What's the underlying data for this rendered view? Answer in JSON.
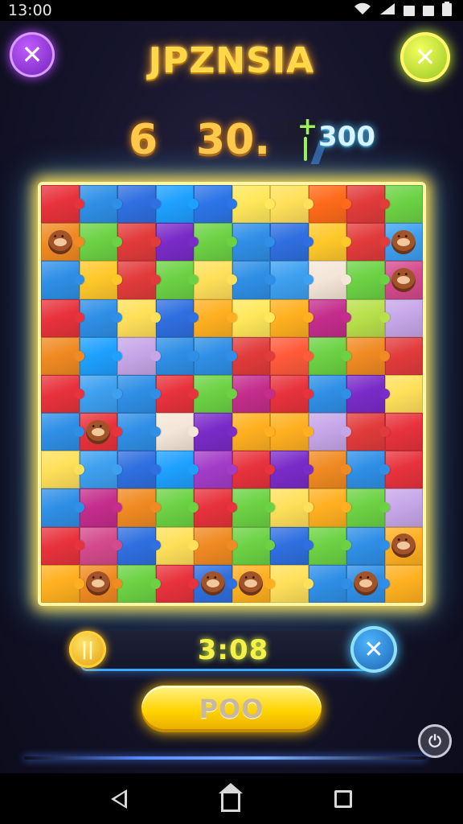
{
  "status_bar": {
    "time": "13:00",
    "icons": [
      "wifi-icon",
      "signal-icon",
      "notification-icon",
      "notification-icon",
      "battery-icon"
    ]
  },
  "header": {
    "title": "JPZNSIA",
    "left_button_icon": "close-icon",
    "right_button_icon": "close-icon"
  },
  "scores": {
    "left": "6",
    "middle": "30.",
    "plus_symbol": "+",
    "bonus": "300"
  },
  "board": {
    "columns": 10,
    "rows": 11,
    "tiles": [
      [
        "#e8323c",
        "#2f8fe6",
        "#2f6fe0",
        "#1ea0ff",
        "#2c75e8",
        "#ffe85a",
        "#ffe05a",
        "#ff6a1a",
        "#e23b3b",
        "#6cd244"
      ],
      [
        "#f08a22",
        "#6cd244",
        "#e23b3b",
        "#7a2bc8",
        "#6cd244",
        "#2f8fe6",
        "#2f6fe0",
        "#ffc82a",
        "#e23b3b",
        "#3da0f0"
      ],
      [
        "#2f8fe6",
        "#ffc82a",
        "#e23b3b",
        "#6cd244",
        "#ffe05a",
        "#2f8fe6",
        "#3da0f0",
        "#f4e6d8",
        "#6cd244",
        "#d44a8c"
      ],
      [
        "#e8323c",
        "#2f8fe6",
        "#ffe05a",
        "#2f6fe0",
        "#ffb020",
        "#ffe85a",
        "#ffb020",
        "#c42d8c",
        "#b8e04a",
        "#c6a6e8"
      ],
      [
        "#f08a22",
        "#1ea0ff",
        "#c6a6e8",
        "#2f8fe6",
        "#2f8fe6",
        "#e23b3b",
        "#ff5a3a",
        "#6cd244",
        "#f08a22",
        "#e23b3b"
      ],
      [
        "#e8323c",
        "#3da0f0",
        "#2f8fe6",
        "#e8323c",
        "#6cd244",
        "#c42d8c",
        "#e8323c",
        "#2f8fe6",
        "#7a2bc8",
        "#ffe05a"
      ],
      [
        "#2f8fe6",
        "#e8323c",
        "#2f8fe6",
        "#f4e6d8",
        "#7a2bc8",
        "#ffb020",
        "#ffb020",
        "#c6a6e8",
        "#e23b3b",
        "#e8323c"
      ],
      [
        "#ffe05a",
        "#3da0f0",
        "#2f6fe0",
        "#1ea0ff",
        "#a33cc8",
        "#e8323c",
        "#7a2bc8",
        "#f08a22",
        "#2f8fe6",
        "#e8323c"
      ],
      [
        "#2f8fe6",
        "#c42d8c",
        "#f08a22",
        "#6cd244",
        "#e8323c",
        "#6cd244",
        "#ffe05a",
        "#ffb020",
        "#6cd244",
        "#c6a6e8"
      ],
      [
        "#e8323c",
        "#d44a8c",
        "#2f6fe0",
        "#ffe05a",
        "#f08a22",
        "#6cd244",
        "#2f6fe0",
        "#6cd244",
        "#2f8fe6",
        "#ffb020"
      ],
      [
        "#ffb020",
        "#f08a22",
        "#6cd244",
        "#e8323c",
        "#2f6fe0",
        "#ffb020",
        "#ffe05a",
        "#2f8fe6",
        "#2f8fe6",
        "#ffb020"
      ]
    ],
    "characters": [
      [
        1,
        0
      ],
      [
        1,
        9
      ],
      [
        2,
        9
      ],
      [
        6,
        1
      ],
      [
        9,
        9
      ],
      [
        10,
        1
      ],
      [
        10,
        4
      ],
      [
        10,
        5
      ],
      [
        10,
        8
      ]
    ]
  },
  "footer": {
    "coin_icon": "coin-icon",
    "timer": "3:08",
    "close_icon": "close-icon",
    "action_label": "POO",
    "power_icon": "power-icon"
  },
  "nav_bar": {
    "icons": [
      "back-icon",
      "home-icon",
      "recent-apps-icon"
    ]
  }
}
